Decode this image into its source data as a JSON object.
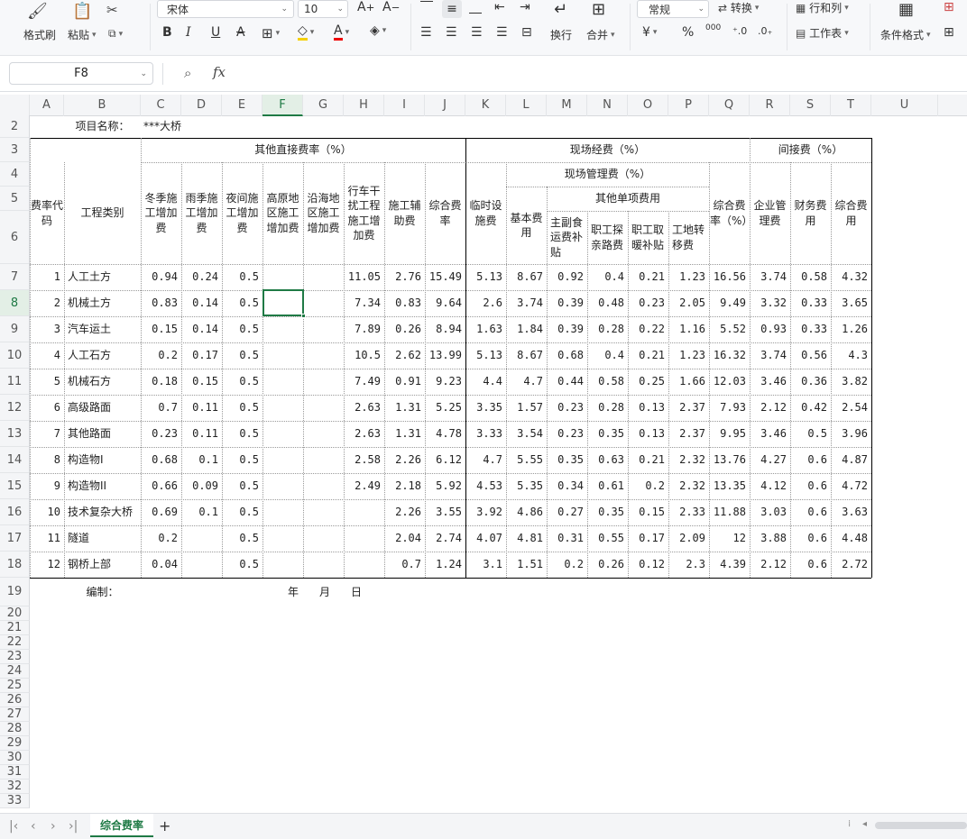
{
  "ribbon": {
    "format_painter": "格式刷",
    "paste": "粘贴",
    "font_name": "宋体",
    "font_size": "10",
    "number_format": "常规",
    "convert": "转换",
    "rows_cols": "行和列",
    "wrap": "换行",
    "merge": "合并",
    "worksheet": "工作表",
    "cond_format": "条件格式",
    "currency": "¥",
    "percent": "%",
    "thousands": "000"
  },
  "formula_bar": {
    "name_box": "F8",
    "fx": "fx",
    "value": ""
  },
  "columns": [
    "A",
    "B",
    "C",
    "D",
    "E",
    "F",
    "G",
    "H",
    "I",
    "J",
    "K",
    "L",
    "M",
    "N",
    "O",
    "P",
    "Q",
    "R",
    "S",
    "T",
    "U"
  ],
  "row_numbers": [
    "2",
    "3",
    "4",
    "5",
    "6",
    "7",
    "8",
    "9",
    "10",
    "11",
    "12",
    "13",
    "14",
    "15",
    "16",
    "17",
    "18",
    "19",
    "20",
    "21",
    "22",
    "23",
    "24",
    "25",
    "26",
    "27",
    "28",
    "29",
    "30",
    "31",
    "32",
    "33"
  ],
  "sheet": {
    "project_label": "项目名称：",
    "project_value": "***大桥",
    "h_other_direct": "其他直接费率（%）",
    "h_site": "现场经费（%）",
    "h_indirect": "间接费（%）",
    "h_site_mgmt": "现场管理费（%）",
    "h_other_single": "其他单项费用",
    "h_code": "费率代码",
    "h_type": "工程类别",
    "h_winter": "冬季施工增加费",
    "h_rain": "雨季施工增加费",
    "h_night": "夜间施工增加费",
    "h_plateau": "高原地区施工增加费",
    "h_coastal": "沿海地区施工增加费",
    "h_traffic": "行车干扰工程施工增加费",
    "h_aux": "施工辅助费",
    "h_total1": "综合费率",
    "h_temp": "临时设施费",
    "h_basic": "基本费用",
    "h_food": "主副食运费补贴",
    "h_family": "职工探亲路费",
    "h_heating": "职工取暖补贴",
    "h_transfer": "工地转移费",
    "h_total2": "综合费率（%）",
    "h_enterprise": "企业管理费",
    "h_finance": "财务费用",
    "h_total3": "综合费用",
    "footer_prepared": "编制：",
    "footer_year": "年",
    "footer_month": "月",
    "footer_day": "日",
    "rows": [
      [
        "1",
        "人工土方",
        "0.94",
        "0.24",
        "0.5",
        "",
        "",
        "11.05",
        "2.76",
        "15.49",
        "5.13",
        "8.67",
        "0.92",
        "0.4",
        "0.21",
        "1.23",
        "16.56",
        "3.74",
        "0.58",
        "4.32"
      ],
      [
        "2",
        "机械土方",
        "0.83",
        "0.14",
        "0.5",
        "",
        "",
        "7.34",
        "0.83",
        "9.64",
        "2.6",
        "3.74",
        "0.39",
        "0.48",
        "0.23",
        "2.05",
        "9.49",
        "3.32",
        "0.33",
        "3.65"
      ],
      [
        "3",
        "汽车运土",
        "0.15",
        "0.14",
        "0.5",
        "",
        "",
        "7.89",
        "0.26",
        "8.94",
        "1.63",
        "1.84",
        "0.39",
        "0.28",
        "0.22",
        "1.16",
        "5.52",
        "0.93",
        "0.33",
        "1.26"
      ],
      [
        "4",
        "人工石方",
        "0.2",
        "0.17",
        "0.5",
        "",
        "",
        "10.5",
        "2.62",
        "13.99",
        "5.13",
        "8.67",
        "0.68",
        "0.4",
        "0.21",
        "1.23",
        "16.32",
        "3.74",
        "0.56",
        "4.3"
      ],
      [
        "5",
        "机械石方",
        "0.18",
        "0.15",
        "0.5",
        "",
        "",
        "7.49",
        "0.91",
        "9.23",
        "4.4",
        "4.7",
        "0.44",
        "0.58",
        "0.25",
        "1.66",
        "12.03",
        "3.46",
        "0.36",
        "3.82"
      ],
      [
        "6",
        "高级路面",
        "0.7",
        "0.11",
        "0.5",
        "",
        "",
        "2.63",
        "1.31",
        "5.25",
        "3.35",
        "1.57",
        "0.23",
        "0.28",
        "0.13",
        "2.37",
        "7.93",
        "2.12",
        "0.42",
        "2.54"
      ],
      [
        "7",
        "其他路面",
        "0.23",
        "0.11",
        "0.5",
        "",
        "",
        "2.63",
        "1.31",
        "4.78",
        "3.33",
        "3.54",
        "0.23",
        "0.35",
        "0.13",
        "2.37",
        "9.95",
        "3.46",
        "0.5",
        "3.96"
      ],
      [
        "8",
        "构造物I",
        "0.68",
        "0.1",
        "0.5",
        "",
        "",
        "2.58",
        "2.26",
        "6.12",
        "4.7",
        "5.55",
        "0.35",
        "0.63",
        "0.21",
        "2.32",
        "13.76",
        "4.27",
        "0.6",
        "4.87"
      ],
      [
        "9",
        "构造物II",
        "0.66",
        "0.09",
        "0.5",
        "",
        "",
        "2.49",
        "2.18",
        "5.92",
        "4.53",
        "5.35",
        "0.34",
        "0.61",
        "0.2",
        "2.32",
        "13.35",
        "4.12",
        "0.6",
        "4.72"
      ],
      [
        "10",
        "技术复杂大桥",
        "0.69",
        "0.1",
        "0.5",
        "",
        "",
        "",
        "2.26",
        "3.55",
        "3.92",
        "4.86",
        "0.27",
        "0.35",
        "0.15",
        "2.33",
        "11.88",
        "3.03",
        "0.6",
        "3.63"
      ],
      [
        "11",
        "隧道",
        "0.2",
        "",
        "0.5",
        "",
        "",
        "",
        "2.04",
        "2.74",
        "4.07",
        "4.81",
        "0.31",
        "0.55",
        "0.17",
        "2.09",
        "12",
        "3.88",
        "0.6",
        "4.48"
      ],
      [
        "12",
        "钢桥上部",
        "0.04",
        "",
        "0.5",
        "",
        "",
        "",
        "0.7",
        "1.24",
        "3.1",
        "1.51",
        "0.2",
        "0.26",
        "0.12",
        "2.3",
        "4.39",
        "2.12",
        "0.6",
        "2.72"
      ]
    ]
  },
  "tabs": {
    "active": "综合费率",
    "add": "+"
  },
  "accent": "#1f7a45"
}
